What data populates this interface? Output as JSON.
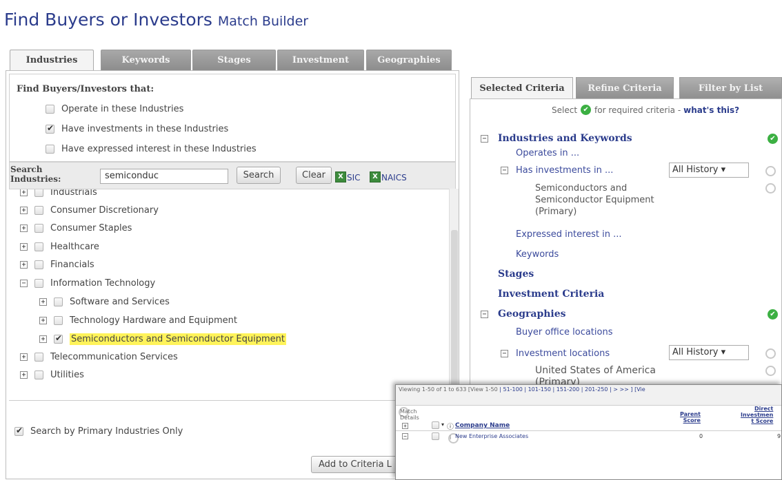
{
  "page": {
    "title": "Find Buyers or Investors",
    "subtitle": "Match Builder"
  },
  "left_tabs": [
    "Industries",
    "Keywords",
    "Stages",
    "Investment",
    "Geographies"
  ],
  "find": {
    "title": "Find Buyers/Investors that:",
    "options": [
      {
        "label": "Operate in these Industries",
        "checked": false
      },
      {
        "label": "Have investments in these Industries",
        "checked": true
      },
      {
        "label": "Have expressed interest in these Industries",
        "checked": false
      }
    ]
  },
  "search": {
    "label_line1": "Search",
    "label_line2": "Industries:",
    "value": "semiconduc",
    "search_button": "Search",
    "clear_button": "Clear",
    "sic_label": "SIC",
    "naics_label": "NAICS"
  },
  "tree": [
    {
      "label": "Industrials",
      "level": 0,
      "toggle": "+",
      "checked": false,
      "highlight": false
    },
    {
      "label": "Consumer Discretionary",
      "level": 0,
      "toggle": "+",
      "checked": false,
      "highlight": false
    },
    {
      "label": "Consumer Staples",
      "level": 0,
      "toggle": "+",
      "checked": false,
      "highlight": false
    },
    {
      "label": "Healthcare",
      "level": 0,
      "toggle": "+",
      "checked": false,
      "highlight": false
    },
    {
      "label": "Financials",
      "level": 0,
      "toggle": "+",
      "checked": false,
      "highlight": false
    },
    {
      "label": "Information Technology",
      "level": 0,
      "toggle": "−",
      "checked": false,
      "highlight": false
    },
    {
      "label": "Software and Services",
      "level": 1,
      "toggle": "+",
      "checked": false,
      "highlight": false
    },
    {
      "label": "Technology Hardware and Equipment",
      "level": 1,
      "toggle": "+",
      "checked": false,
      "highlight": false
    },
    {
      "label": "Semiconductors and Semiconductor Equipment",
      "level": 1,
      "toggle": "+",
      "checked": true,
      "highlight": true
    },
    {
      "label": "Telecommunication Services",
      "level": 0,
      "toggle": "+",
      "checked": false,
      "highlight": false
    },
    {
      "label": "Utilities",
      "level": 0,
      "toggle": "+",
      "checked": false,
      "highlight": false
    }
  ],
  "primary_only": {
    "label": "Search by Primary Industries Only",
    "checked": true
  },
  "add_button": "Add to Criteria L",
  "right_tabs": [
    "Selected Criteria",
    "Refine Criteria",
    "Filter by List"
  ],
  "select_note": {
    "prefix": "Select",
    "suffix": "for required criteria -",
    "link": "what's this?"
  },
  "criteria": {
    "industries_keywords": "Industries and Keywords",
    "operates_in": "Operates in ...",
    "has_investments": "Has investments in ...",
    "history_select_1": "All History",
    "semi_line1": "Semiconductors and",
    "semi_line2": "Semiconductor Equipment",
    "semi_line3": "(Primary)",
    "expressed_interest": "Expressed interest in ...",
    "keywords": "Keywords",
    "stages": "Stages",
    "investment_criteria": "Investment Criteria",
    "geographies": "Geographies",
    "buyer_office": "Buyer office locations",
    "investment_locations": "Investment locations",
    "history_select_2": "All History",
    "usa_line1": "United States of America",
    "usa_line2": "(Primary)"
  },
  "results": {
    "viewing": "Viewing 1-50 of 1 to 633 [View 1-50",
    "pages": "| 51-100 | 101-150 | 151-200 | 201-250 | > >> ] [Vie",
    "match_details_1": "Match",
    "match_details_2": "Details",
    "company_name_header": "Company Name",
    "parent_score_1": "Parent",
    "parent_score_2": "Score",
    "direct_1": "Direct",
    "direct_2": "Investmen",
    "direct_3": "t Score",
    "row_company": "New Enterprise Associates",
    "row_parent_score": "0",
    "row_direct_score": "9"
  }
}
